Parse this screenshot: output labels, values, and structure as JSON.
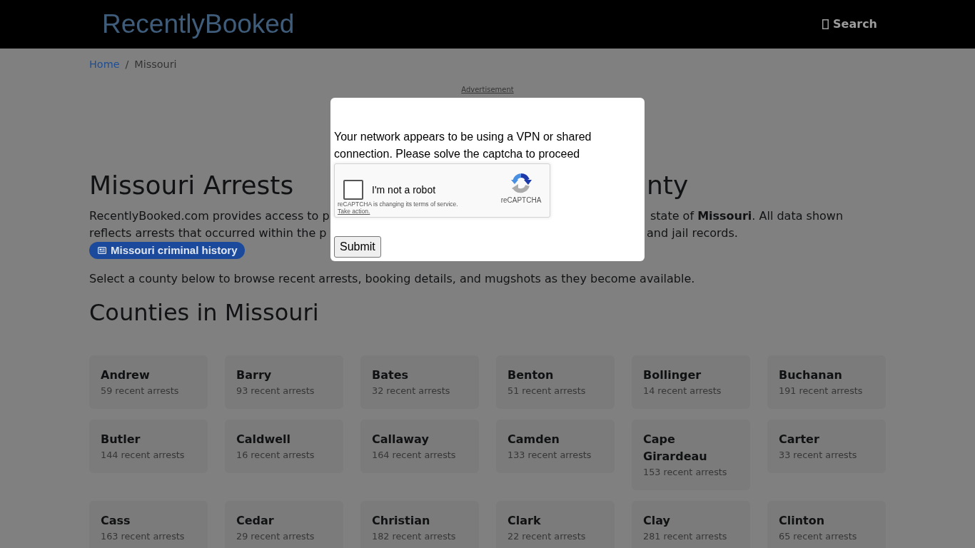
{
  "header": {
    "logo": "RecentlyBooked",
    "search": "Search"
  },
  "breadcrumb": {
    "separator": "/",
    "items": [
      {
        "label": "Home",
        "kind": "link"
      },
      {
        "label": "Missouri",
        "kind": "current"
      }
    ]
  },
  "ad_label": "Advertisement",
  "heading_parts": [
    "Missouri Arrests",
    "nty"
  ],
  "intro_lines": [
    {
      "left": "RecentlyBooked.com provides access to p",
      "right": "state of **Missouri**. All data shown"
    },
    {
      "left": "reflects arrests that occurred within the p",
      "right": "and jail records."
    }
  ],
  "history_badge": "Missouri criminal history",
  "select_prompt": "Select a county below to browse recent arrests, booking details, and mugshots as they become available.",
  "counties_heading": "Counties in Missouri",
  "counties": [
    {
      "name": "Andrew",
      "count": "59 recent arrests"
    },
    {
      "name": "Barry",
      "count": "93 recent arrests"
    },
    {
      "name": "Bates",
      "count": "32 recent arrests"
    },
    {
      "name": "Benton",
      "count": "51 recent arrests"
    },
    {
      "name": "Bollinger",
      "count": "14 recent arrests"
    },
    {
      "name": "Buchanan",
      "count": "191 recent arrests"
    },
    {
      "name": "Butler",
      "count": "144 recent arrests"
    },
    {
      "name": "Caldwell",
      "count": "16 recent arrests"
    },
    {
      "name": "Callaway",
      "count": "164 recent arrests"
    },
    {
      "name": "Camden",
      "count": "133 recent arrests"
    },
    {
      "name": "Cape Girardeau",
      "count": "153 recent arrests"
    },
    {
      "name": "Carter",
      "count": "33 recent arrests"
    },
    {
      "name": "Cass",
      "count": "163 recent arrests"
    },
    {
      "name": "Cedar",
      "count": "29 recent arrests"
    },
    {
      "name": "Christian",
      "count": "182 recent arrests"
    },
    {
      "name": "Clark",
      "count": "22 recent arrests"
    },
    {
      "name": "Clay",
      "count": "281 recent arrests"
    },
    {
      "name": "Clinton",
      "count": "65 recent arrests"
    }
  ],
  "captcha_modal": {
    "message": "Your network appears to be using a VPN or shared connection. Please solve the captcha to proceed",
    "captcha": {
      "checked": false,
      "label": "I'm not a robot",
      "brand": "reCAPTCHA",
      "notice": "reCAPTCHA is changing its terms of service.",
      "notice_link": "Take action."
    },
    "submit": "Submit"
  }
}
